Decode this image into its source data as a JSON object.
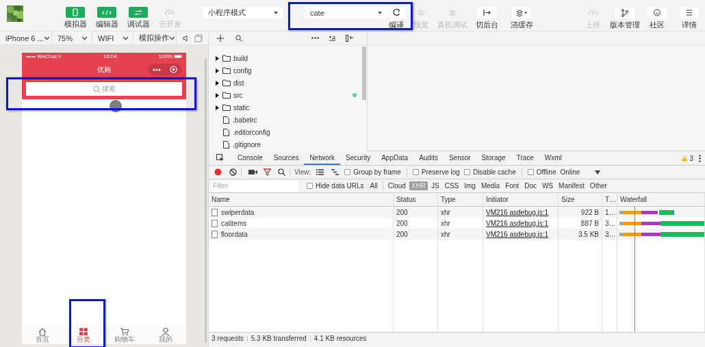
{
  "toolbar": {
    "view_buttons": [
      {
        "label": "模拟器",
        "on": true,
        "disabled": false
      },
      {
        "label": "编辑器",
        "on": true,
        "disabled": false
      },
      {
        "label": "调试器",
        "on": true,
        "disabled": false
      },
      {
        "label": "云开发",
        "on": false,
        "disabled": true
      }
    ],
    "mode_select": "小程序模式",
    "compile_select": "cate",
    "actions": [
      {
        "label": "编译",
        "disabled": false
      },
      {
        "label": "预览",
        "disabled": true
      },
      {
        "label": "真机调试",
        "disabled": true
      },
      {
        "label": "切后台",
        "disabled": false
      },
      {
        "label": "清缓存",
        "disabled": false
      }
    ],
    "right_actions": [
      {
        "label": "上传",
        "disabled": true
      },
      {
        "label": "版本管理",
        "disabled": false
      },
      {
        "label": "社区",
        "disabled": false
      },
      {
        "label": "详情",
        "disabled": false
      }
    ]
  },
  "simulator_bar": {
    "device": "iPhone 6 ...",
    "zoom": "75%",
    "network": "WIFI",
    "operation": "模拟操作"
  },
  "phone": {
    "carrier": "••••• WeChat",
    "time": "10:04",
    "battery": "100%",
    "title": "优购",
    "search_placeholder": "搜索",
    "tabs": [
      {
        "label": "首页",
        "selected": false
      },
      {
        "label": "分类",
        "selected": true
      },
      {
        "label": "购物车",
        "selected": false
      },
      {
        "label": "我的",
        "selected": false
      }
    ]
  },
  "file_tree": {
    "items": [
      {
        "name": "build",
        "kind": "folder",
        "expanded": false,
        "modified": false
      },
      {
        "name": "config",
        "kind": "folder",
        "expanded": false,
        "modified": false
      },
      {
        "name": "dist",
        "kind": "folder",
        "expanded": false,
        "modified": false
      },
      {
        "name": "src",
        "kind": "folder",
        "expanded": false,
        "modified": true
      },
      {
        "name": "static",
        "kind": "folder",
        "expanded": false,
        "modified": false
      },
      {
        "name": ".babelrc",
        "kind": "file",
        "modified": false
      },
      {
        "name": ".editorconfig",
        "kind": "file",
        "modified": false
      },
      {
        "name": ".gitignore",
        "kind": "file",
        "modified": false
      }
    ]
  },
  "devtools": {
    "tabs": [
      {
        "label": "Console",
        "selected": false
      },
      {
        "label": "Sources",
        "selected": false
      },
      {
        "label": "Network",
        "selected": true
      },
      {
        "label": "Security",
        "selected": false
      },
      {
        "label": "AppData",
        "selected": false
      },
      {
        "label": "Audits",
        "selected": false
      },
      {
        "label": "Sensor",
        "selected": false
      },
      {
        "label": "Storage",
        "selected": false
      },
      {
        "label": "Trace",
        "selected": false
      },
      {
        "label": "Wxml",
        "selected": false
      }
    ],
    "warning_count": "3",
    "recording": true,
    "filter_active": true,
    "view_label": "View:",
    "options": [
      {
        "label": "Group by frame",
        "checked": false
      },
      {
        "label": "Preserve log",
        "checked": false
      },
      {
        "label": "Disable cache",
        "checked": false
      },
      {
        "label": "Offline",
        "checked": false
      }
    ],
    "throttle": "Online",
    "filter_placeholder": "Filter",
    "hide_data_urls": {
      "label": "Hide data URLs",
      "checked": false
    },
    "type_filters": [
      {
        "label": "All",
        "selected": false
      },
      {
        "label": "Cloud",
        "selected": false
      },
      {
        "label": "XHR",
        "selected": true
      },
      {
        "label": "JS",
        "selected": false
      },
      {
        "label": "CSS",
        "selected": false
      },
      {
        "label": "Img",
        "selected": false
      },
      {
        "label": "Media",
        "selected": false
      },
      {
        "label": "Font",
        "selected": false
      },
      {
        "label": "Doc",
        "selected": false
      },
      {
        "label": "WS",
        "selected": false
      },
      {
        "label": "Manifest",
        "selected": false
      },
      {
        "label": "Other",
        "selected": false
      }
    ],
    "columns": [
      "Name",
      "Status",
      "Type",
      "Initiator",
      "Size",
      "T…",
      "Waterfall"
    ],
    "rows": [
      {
        "name": "swiperdata",
        "status": "200",
        "type": "xhr",
        "initiator": "VM216 asdebug.js:1",
        "size": "922 B",
        "time": "1…"
      },
      {
        "name": "catitems",
        "status": "200",
        "type": "xhr",
        "initiator": "VM216 asdebug.js:1",
        "size": "887 B",
        "time": "3…"
      },
      {
        "name": "floordata",
        "status": "200",
        "type": "xhr",
        "initiator": "VM216 asdebug.js:1",
        "size": "3.5 KB",
        "time": "3…"
      }
    ],
    "summary": [
      "3 requests",
      "5.3 KB transferred",
      "4.1 KB resources"
    ]
  }
}
